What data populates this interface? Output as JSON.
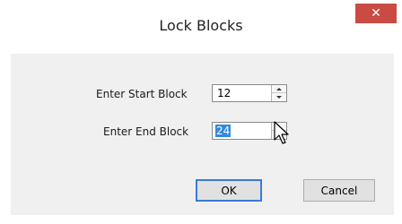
{
  "window": {
    "title": "Lock Blocks",
    "close_icon": "✕"
  },
  "form": {
    "start_label": "Enter Start Block",
    "start_value": "12",
    "end_label": "Enter End Block",
    "end_value": "24"
  },
  "buttons": {
    "ok": "OK",
    "cancel": "Cancel"
  },
  "colors": {
    "close_button": "#c94b44",
    "selection": "#3388dd",
    "dialog_background": "#f0f0f0"
  }
}
